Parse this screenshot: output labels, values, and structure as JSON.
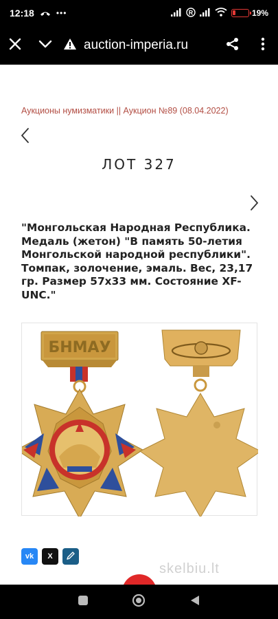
{
  "status_bar": {
    "time": "12:18",
    "dots": "•••",
    "battery_percent": "19",
    "battery_level": 0.19,
    "icons": [
      "missed-call-icon",
      "more-dots-icon",
      "cell-signal-icon",
      "roaming-r-icon",
      "cell-signal-2-icon",
      "wifi-icon",
      "battery-icon"
    ]
  },
  "browser": {
    "url": "auction-imperia.ru",
    "icons": [
      "close-icon",
      "chevron-down-icon",
      "warning-icon",
      "share-icon",
      "more-vert-icon"
    ]
  },
  "breadcrumb": "Аукционы нумизматики || Аукцион №89 (08.04.2022)",
  "lot": {
    "title": "ЛОТ 327",
    "description_lines": [
      "\"Монгольская Народная Республика.",
      "Медаль (жетон) \"В память 50-летия",
      "Монгольской народной республики\".",
      "Томпак, золочение, эмаль. Вес, 23,17",
      "гр. Размер 57х33 мм. Состояние XF-",
      "UNC.\""
    ],
    "medal_plate_text": "БНМАУ"
  },
  "share": {
    "vk_label": "vk",
    "x_label": "X"
  },
  "watermark": "skelbiu.lt",
  "colors": {
    "breadcrumb": "#b24d43",
    "gold": "#d4a24a",
    "enamel_red": "#c8322a",
    "enamel_blue": "#2e4f9c",
    "fab_red": "#e02828"
  }
}
